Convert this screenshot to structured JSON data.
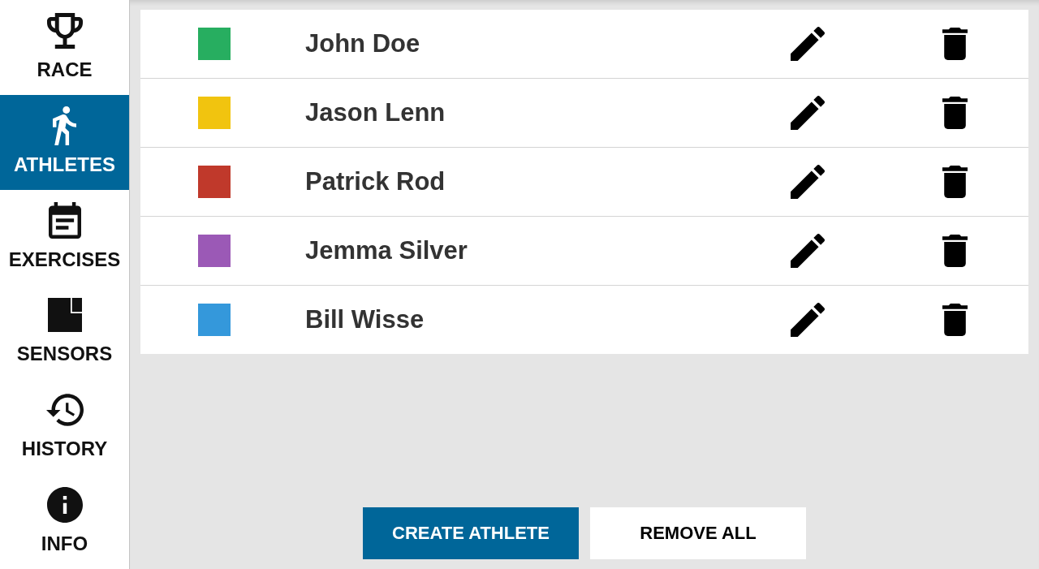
{
  "sidebar": {
    "items": [
      {
        "label": "RACE",
        "selected": false
      },
      {
        "label": "ATHLETES",
        "selected": true
      },
      {
        "label": "EXERCISES",
        "selected": false
      },
      {
        "label": "SENSORS",
        "selected": false
      },
      {
        "label": "HISTORY",
        "selected": false
      },
      {
        "label": "INFO",
        "selected": false
      }
    ]
  },
  "athletes": [
    {
      "name": "John Doe",
      "color": "#27ae60"
    },
    {
      "name": "Jason Lenn",
      "color": "#f1c40f"
    },
    {
      "name": "Patrick Rod",
      "color": "#c0392b"
    },
    {
      "name": "Jemma Silver",
      "color": "#9b59b6"
    },
    {
      "name": "Bill Wisse",
      "color": "#3498db"
    }
  ],
  "buttons": [
    {
      "label": "CREATE ATHLETE",
      "kind": "primary"
    },
    {
      "label": "REMOVE ALL",
      "kind": "secondary"
    }
  ]
}
